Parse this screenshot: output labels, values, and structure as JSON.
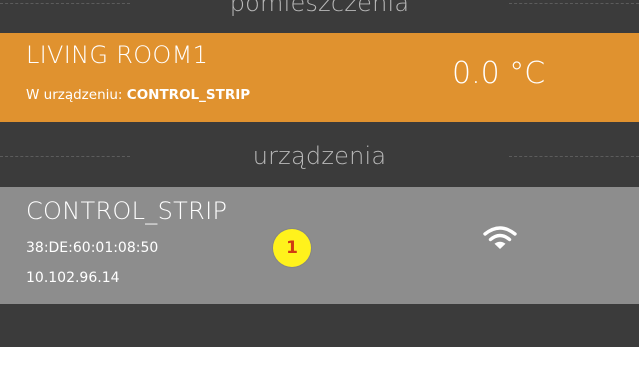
{
  "sections": {
    "rooms_title": "pomieszczenia",
    "devices_title": "urządzenia"
  },
  "room": {
    "name": "LIVING ROOM1",
    "device_prefix": "W urządzeniu: ",
    "device_name": "CONTROL_STRIP",
    "temperature": "0.0 °C"
  },
  "device": {
    "name": "CONTROL_STRIP",
    "mac": "38:DE:60:01:08:50",
    "ip": "10.102.96.14",
    "status_icon": "wifi-icon"
  },
  "annotation": {
    "label": "1",
    "color": "#fff21c"
  },
  "colors": {
    "background": "#3b3b3b",
    "room_card": "#e0922f",
    "device_card": "#8d8d8d"
  }
}
